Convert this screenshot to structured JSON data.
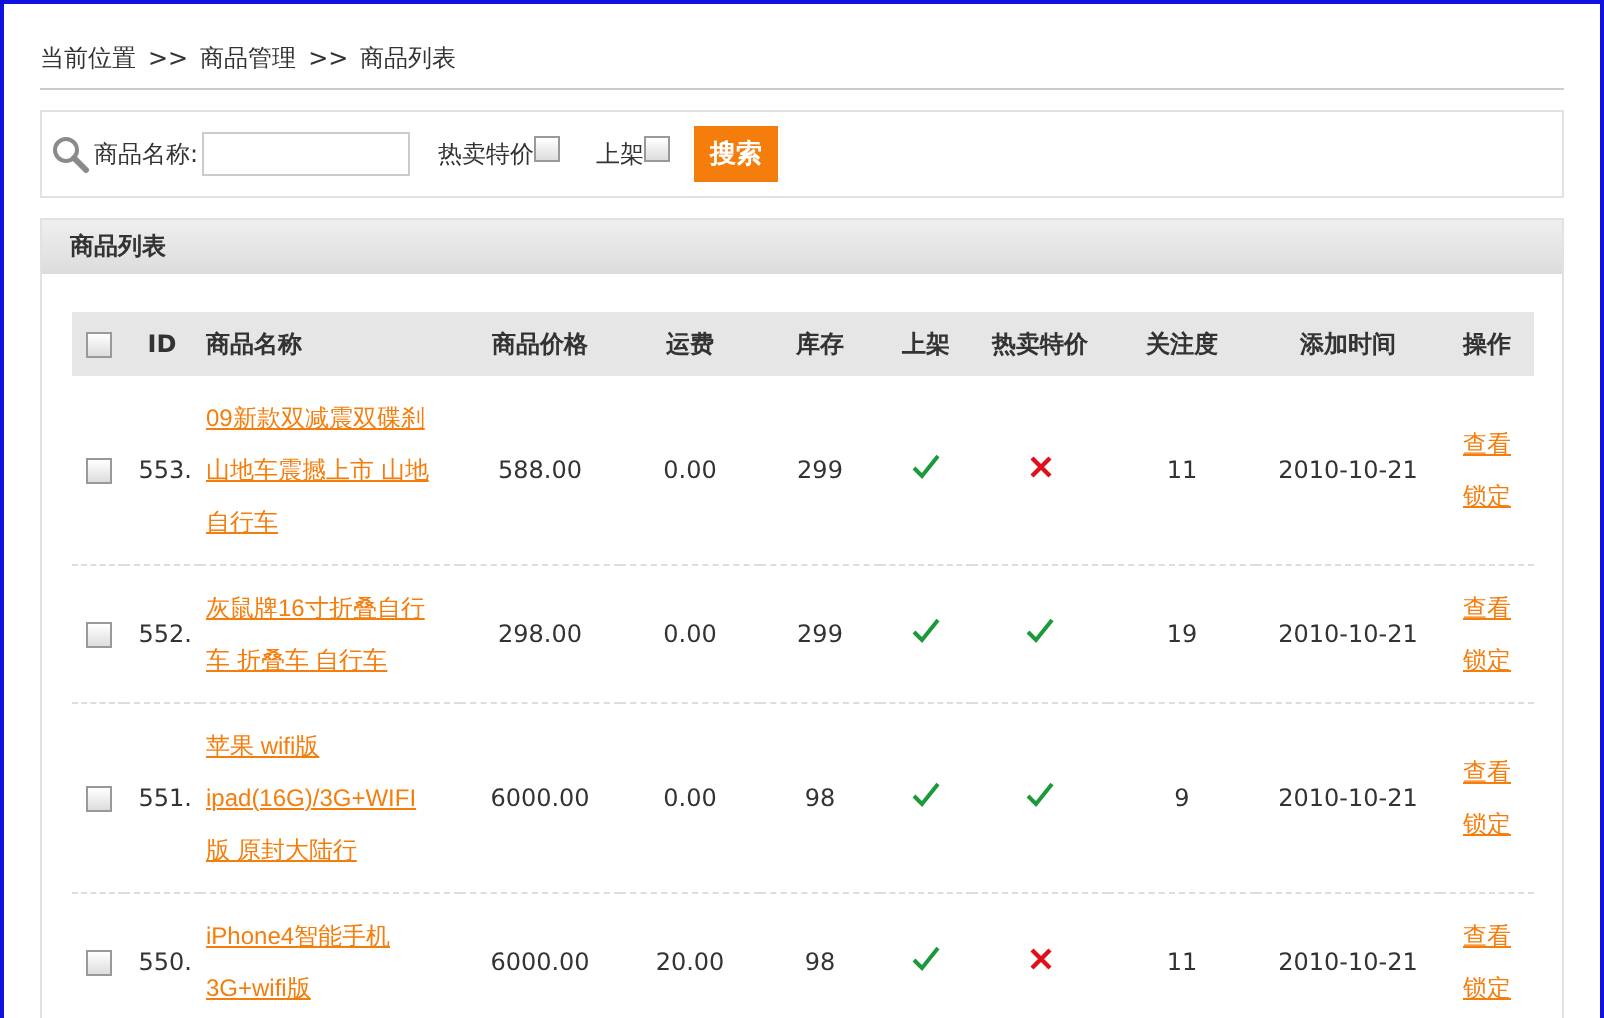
{
  "breadcrumb": {
    "items": [
      "当前位置",
      ">>",
      "商品管理",
      ">>",
      "商品列表"
    ]
  },
  "search": {
    "label": "商品名称:",
    "filters": [
      {
        "label": "热卖特价",
        "checked": false
      },
      {
        "label": "上架",
        "checked": false
      }
    ],
    "button": "搜索"
  },
  "panel": {
    "title": "商品列表"
  },
  "table": {
    "select_all": {
      "checked": false
    },
    "columns": [
      "ID",
      "商品名称",
      "商品价格",
      "运费",
      "库存",
      "上架",
      "热卖特价",
      "关注度",
      "添加时间",
      "操作"
    ],
    "rows": [
      {
        "checked": false,
        "id": "553.",
        "name": "09新款双减震双碟刹山地车震撼上市 山地自行车",
        "price": "588.00",
        "freight": "0.00",
        "stock": "299",
        "on_shelf": true,
        "hot_sale": false,
        "attention": "11",
        "added": "2010-10-21",
        "actions": [
          "查看",
          "锁定"
        ]
      },
      {
        "checked": false,
        "id": "552.",
        "name": "灰鼠牌16寸折叠自行车 折叠车 自行车",
        "price": "298.00",
        "freight": "0.00",
        "stock": "299",
        "on_shelf": true,
        "hot_sale": true,
        "attention": "19",
        "added": "2010-10-21",
        "actions": [
          "查看",
          "锁定"
        ]
      },
      {
        "checked": false,
        "id": "551.",
        "name": "苹果 wifi版 ipad(16G)/3G+WIFI版 原封大陆行",
        "price": "6000.00",
        "freight": "0.00",
        "stock": "98",
        "on_shelf": true,
        "hot_sale": true,
        "attention": "9",
        "added": "2010-10-21",
        "actions": [
          "查看",
          "锁定"
        ]
      },
      {
        "checked": false,
        "id": "550.",
        "name": "iPhone4智能手机 3G+wifi版",
        "price": "6000.00",
        "freight": "20.00",
        "stock": "98",
        "on_shelf": true,
        "hot_sale": false,
        "attention": "11",
        "added": "2010-10-21",
        "actions": [
          "查看",
          "锁定"
        ]
      }
    ]
  }
}
